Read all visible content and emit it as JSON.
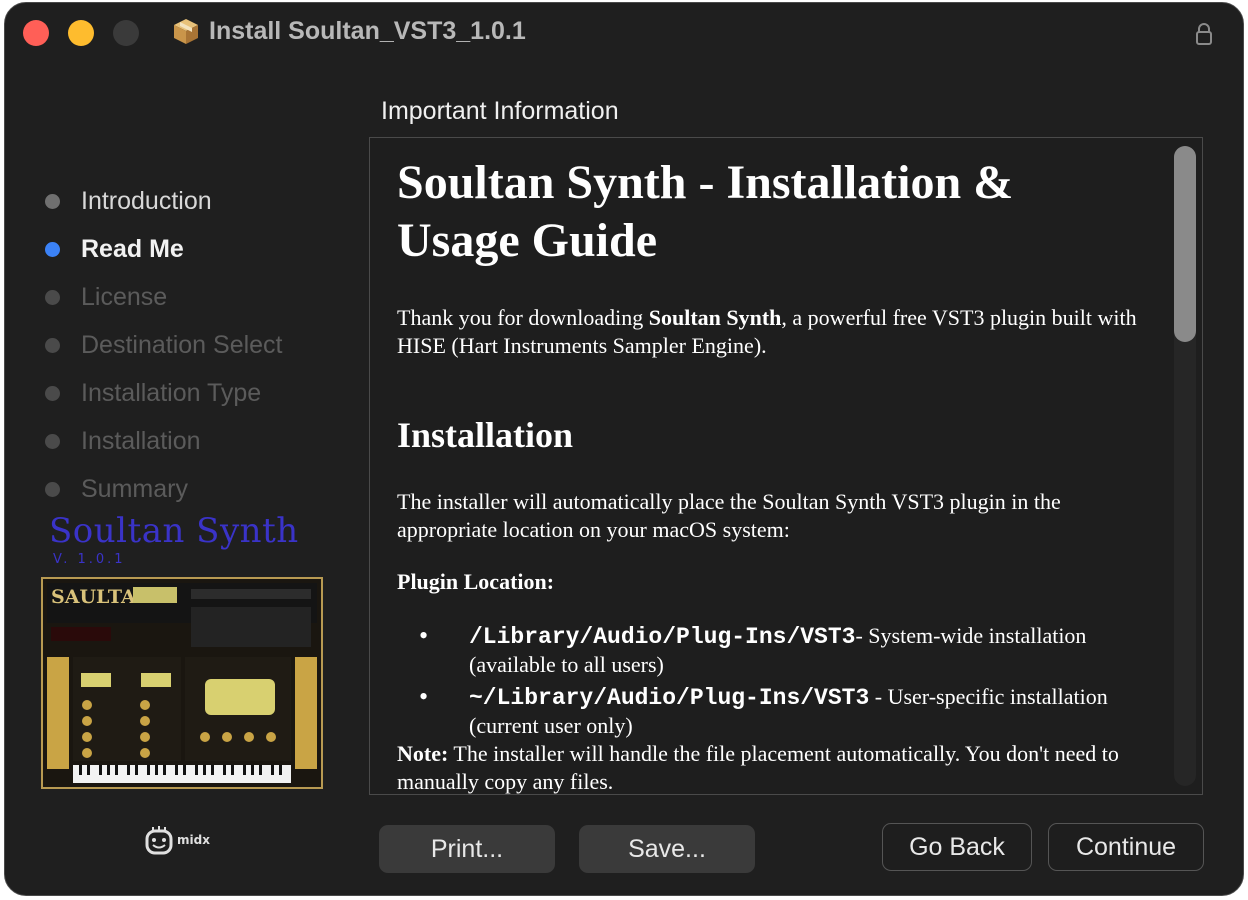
{
  "window": {
    "title": "Install Soultan_VST3_1.0.1",
    "icons": {
      "app": "package-icon",
      "lock": "lock-icon"
    },
    "traffic_lights": {
      "close": "#ff5f57",
      "minimize": "#febc2e",
      "zoom": "#3a3a3a"
    }
  },
  "sidebar": {
    "steps": [
      {
        "label": "Introduction",
        "state": "done"
      },
      {
        "label": "Read Me",
        "state": "current"
      },
      {
        "label": "License",
        "state": "pending"
      },
      {
        "label": "Destination Select",
        "state": "pending"
      },
      {
        "label": "Installation Type",
        "state": "pending"
      },
      {
        "label": "Installation",
        "state": "pending"
      },
      {
        "label": "Summary",
        "state": "pending"
      }
    ],
    "brand": "Soultan Synth",
    "version": "V. 1.0.1",
    "plugin_logo": "SAULTAN",
    "vendor": "midx",
    "accent": "#3b82f6",
    "brand_color": "#3a33c8"
  },
  "main": {
    "section_title": "Important Information",
    "doc": {
      "title": "Soultan Synth - Installation & Usage Guide",
      "intro_before": "Thank you for downloading ",
      "intro_bold": "Soultan Synth",
      "intro_after": ", a powerful free VST3 plugin built with HISE (Hart Instruments Sampler Engine).",
      "installation_heading": "Installation",
      "installation_text": "The installer will automatically place the Soultan Synth VST3 plugin in the appropriate location on your macOS system:",
      "plugin_location_label": "Plugin Location:",
      "locations": [
        {
          "path": "/Library/Audio/Plug-Ins/VST3",
          "desc": "- System-wide installation (available to all users)"
        },
        {
          "path": "~/Library/Audio/Plug-Ins/VST3",
          "desc": " - User-specific installation (current user only)"
        }
      ],
      "note_label": "Note:",
      "note_text": " The installer will handle the file placement automatically. You don't need to manually copy any files."
    }
  },
  "buttons": {
    "print": "Print...",
    "save": "Save...",
    "go_back": "Go Back",
    "continue": "Continue"
  }
}
